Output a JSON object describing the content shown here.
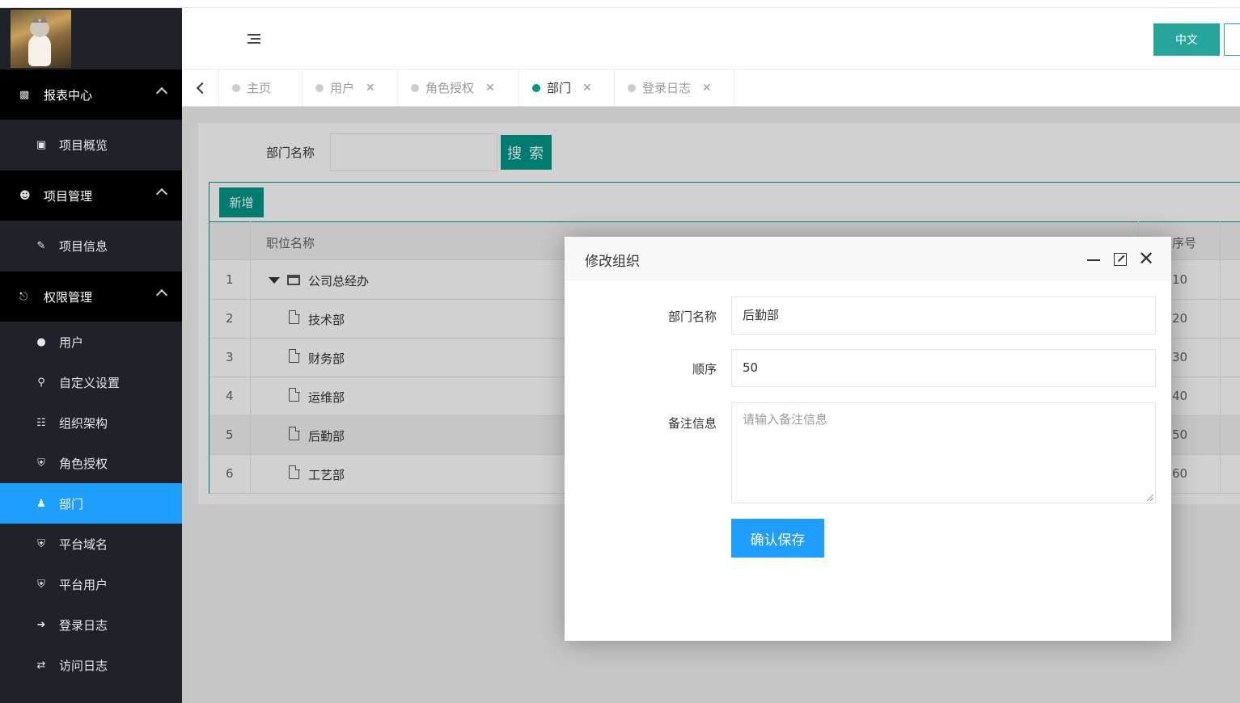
{
  "sidebar": {
    "groups": [
      {
        "label": "报表中心",
        "icon": "bar-chart-icon",
        "items": [
          {
            "label": "项目概览",
            "icon": "image-icon"
          }
        ]
      },
      {
        "label": "项目管理",
        "icon": "user-tie-icon",
        "items": [
          {
            "label": "项目信息",
            "icon": "pen-icon"
          }
        ]
      },
      {
        "label": "权限管理",
        "icon": "unlock-icon",
        "items": [
          {
            "label": "用户",
            "icon": "user-icon"
          },
          {
            "label": "自定义设置",
            "icon": "key-icon"
          },
          {
            "label": "组织架构",
            "icon": "sitemap-icon"
          },
          {
            "label": "角色授权",
            "icon": "shield-icon"
          },
          {
            "label": "部门",
            "icon": "users-icon",
            "active": true
          },
          {
            "label": "平台域名",
            "icon": "shield-icon"
          },
          {
            "label": "平台用户",
            "icon": "shield-icon"
          },
          {
            "label": "登录日志",
            "icon": "sign-in-icon"
          },
          {
            "label": "访问日志",
            "icon": "random-icon"
          }
        ]
      }
    ]
  },
  "header": {
    "lang_button": "中文"
  },
  "tabs": [
    {
      "label": "主页",
      "closable": false
    },
    {
      "label": "用户",
      "closable": true
    },
    {
      "label": "角色授权",
      "closable": true
    },
    {
      "label": "部门",
      "closable": true,
      "active": true
    },
    {
      "label": "登录日志",
      "closable": true
    }
  ],
  "search": {
    "label": "部门名称",
    "value": "",
    "button": "搜 索"
  },
  "table": {
    "add_button": "新增",
    "headers": {
      "name": "职位名称",
      "sort": "排序号"
    },
    "rows": [
      {
        "num": "1",
        "name": "公司总经办",
        "sort": "10",
        "type": "folder"
      },
      {
        "num": "2",
        "name": "技术部",
        "sort": "20",
        "type": "file"
      },
      {
        "num": "3",
        "name": "财务部",
        "sort": "30",
        "type": "file"
      },
      {
        "num": "4",
        "name": "运维部",
        "sort": "40",
        "type": "file"
      },
      {
        "num": "5",
        "name": "后勤部",
        "sort": "50",
        "type": "file"
      },
      {
        "num": "6",
        "name": "工艺部",
        "sort": "60",
        "type": "file"
      }
    ]
  },
  "modal": {
    "title": "修改组织",
    "fields": {
      "name_label": "部门名称",
      "name_value": "后勤部",
      "order_label": "顺序",
      "order_value": "50",
      "remark_label": "备注信息",
      "remark_placeholder": "请输入备注信息"
    },
    "save_button": "确认保存"
  },
  "colors": {
    "sidebar_bg": "#20222a",
    "active_blue": "#1e9fff",
    "teal": "#009688",
    "lang_teal": "#26a69a"
  }
}
